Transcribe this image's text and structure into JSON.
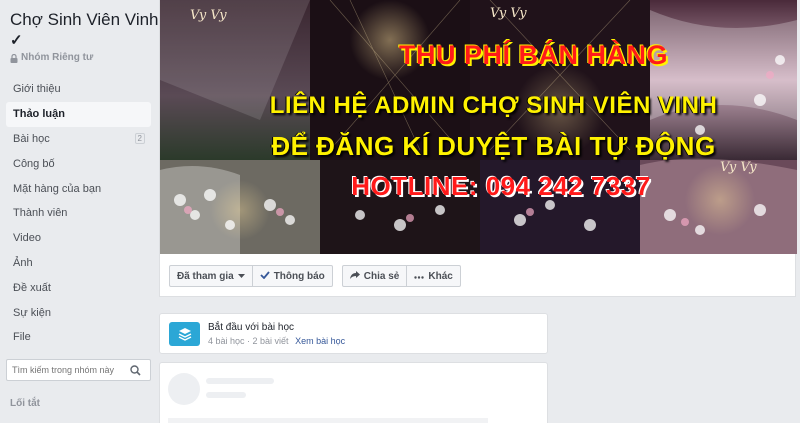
{
  "group": {
    "name": "Chợ Sinh Viên Vinh",
    "check": "✓",
    "privacy": "Nhóm Riêng tư"
  },
  "nav": [
    {
      "label": "Giới thiệu",
      "badge": ""
    },
    {
      "label": "Thảo luận",
      "badge": "",
      "active": true
    },
    {
      "label": "Bài học",
      "badge": "2"
    },
    {
      "label": "Công bố",
      "badge": ""
    },
    {
      "label": "Mặt hàng của bạn",
      "badge": ""
    },
    {
      "label": "Thành viên",
      "badge": ""
    },
    {
      "label": "Video",
      "badge": ""
    },
    {
      "label": "Ảnh",
      "badge": ""
    },
    {
      "label": "Đề xuất",
      "badge": ""
    },
    {
      "label": "Sự kiện",
      "badge": ""
    },
    {
      "label": "File",
      "badge": ""
    }
  ],
  "search": {
    "placeholder": "Tìm kiếm trong nhóm này"
  },
  "shortcuts_label": "Lối tắt",
  "cover": {
    "line1": "THU PHÍ BÁN HÀNG",
    "line2": "LIÊN HỆ ADMIN CHỢ SINH VIÊN VINH",
    "line3": "ĐỂ ĐĂNG KÍ DUYỆT BÀI TỰ ĐỘNG",
    "line4": "HOTLINE: 094 242 7337",
    "logo": "Vy Vy"
  },
  "actions": {
    "joined": "Đã tham gia",
    "notifications": "Thông báo",
    "share": "Chia sẻ",
    "more": "Khác"
  },
  "lessons": {
    "title": "Bắt đầu với bài học",
    "meta": "4 bài học · 2 bài viết",
    "link": "Xem bài học"
  },
  "colors": {
    "accent": "#365899",
    "lesson_icon": "#2ba7d6",
    "cover_red": "#ff1a1a",
    "cover_yellow": "#fff200"
  }
}
